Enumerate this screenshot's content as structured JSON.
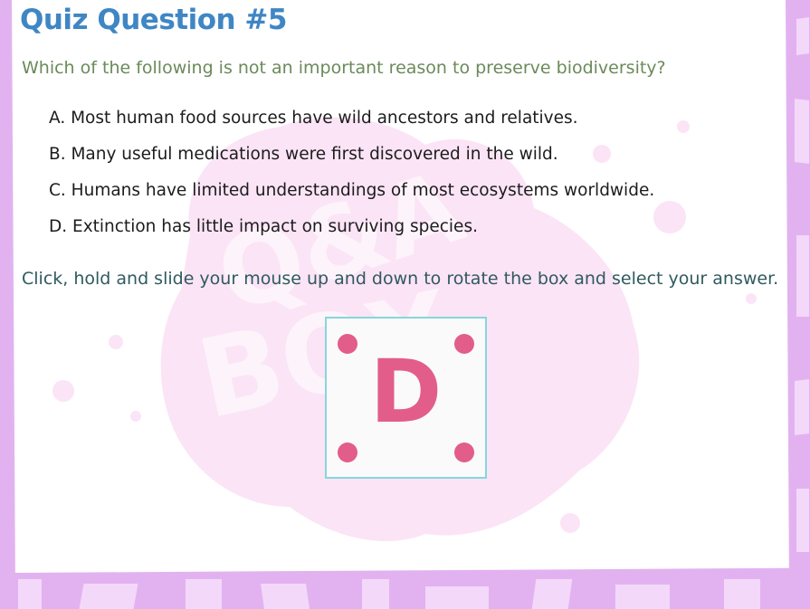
{
  "quiz": {
    "title": "Quiz Question #5",
    "question": "Which of the following is not an important reason to preserve biodiversity?",
    "options": [
      {
        "label": "A. Most human food sources have wild ancestors and relatives."
      },
      {
        "label": "B. Many useful medications were first discovered in the wild."
      },
      {
        "label": "C. Humans have limited understandings of most ecosystems worldwide."
      },
      {
        "label": "D. Extinction has little impact on surviving species."
      }
    ],
    "instruction": "Click, hold and slide your mouse up and down to rotate the box and select your answer.",
    "answer_box": {
      "current_letter": "D"
    }
  },
  "watermark_text": [
    "Q&A",
    "BOX"
  ],
  "colors": {
    "frame": "#e2b2f0",
    "title": "#3f86c4",
    "question": "#6b8a5a",
    "instruction": "#2f5a5f",
    "accent_pink": "#e25d8a",
    "box_border": "#86d6dc",
    "watermark": "#fbe4f6"
  }
}
